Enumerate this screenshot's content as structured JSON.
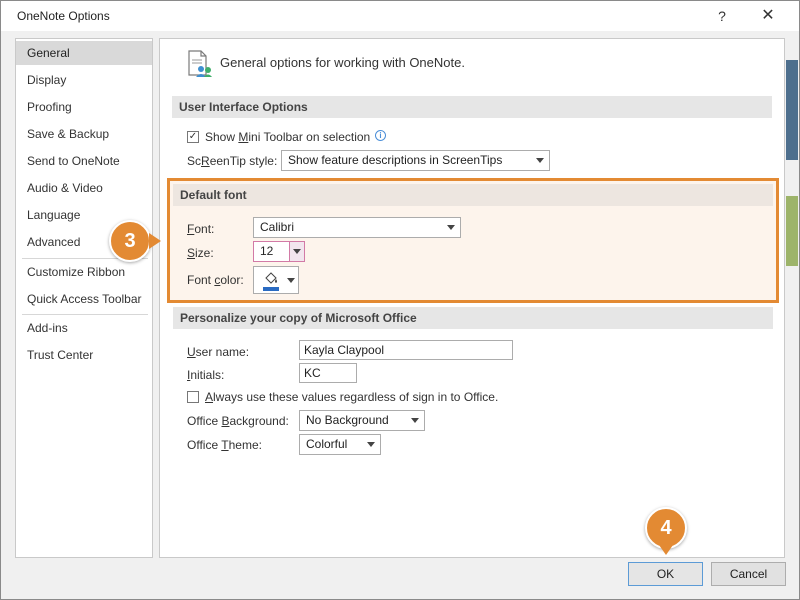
{
  "window": {
    "title": "OneNote Options",
    "help_glyph": "?",
    "close_glyph": "✕"
  },
  "nav": {
    "items": [
      "General",
      "Display",
      "Proofing",
      "Save & Backup",
      "Send to OneNote",
      "Audio & Video",
      "Language",
      "Advanced",
      "Customize Ribbon",
      "Quick Access Toolbar",
      "Add-ins",
      "Trust Center"
    ],
    "active": "General"
  },
  "intro": {
    "text": "General options for working with OneNote."
  },
  "ui_options": {
    "header": "User Interface Options",
    "mini_toolbar": {
      "prefix": "Show ",
      "accel": "M",
      "suffix": "ini Toolbar on selection",
      "checked": true
    },
    "screentip": {
      "label_accel": "R",
      "label_pre": "Sc",
      "label_post": "eenTip style:",
      "value": "Show feature descriptions in ScreenTips"
    }
  },
  "default_font": {
    "header": "Default font",
    "font": {
      "label_accel": "F",
      "label_post": "ont:",
      "value": "Calibri"
    },
    "size": {
      "label_accel": "S",
      "label_post": "ize:",
      "value": "12"
    },
    "color": {
      "label_pre": "Font ",
      "label_accel": "c",
      "label_post": "olor:",
      "swatch": "#2a6bc2"
    }
  },
  "personalize": {
    "header": "Personalize your copy of Microsoft Office",
    "user_name": {
      "label_accel": "U",
      "label_post": "ser name:",
      "value": "Kayla Claypool"
    },
    "initials": {
      "label_accel": "I",
      "label_post": "nitials:",
      "value": "KC"
    },
    "always_use": {
      "label_accel": "A",
      "label_post": "lways use these values regardless of sign in to Office.",
      "checked": false
    },
    "office_background": {
      "label_pre": "Office ",
      "label_accel": "B",
      "label_post": "ackground:",
      "value": "No Background"
    },
    "office_theme": {
      "label_pre": "Office ",
      "label_accel": "T",
      "label_post": "heme:",
      "value": "Colorful"
    }
  },
  "callouts": {
    "step3": "3",
    "step4": "4",
    "accent": "#e38a33"
  },
  "buttons": {
    "ok": "OK",
    "cancel": "Cancel"
  }
}
